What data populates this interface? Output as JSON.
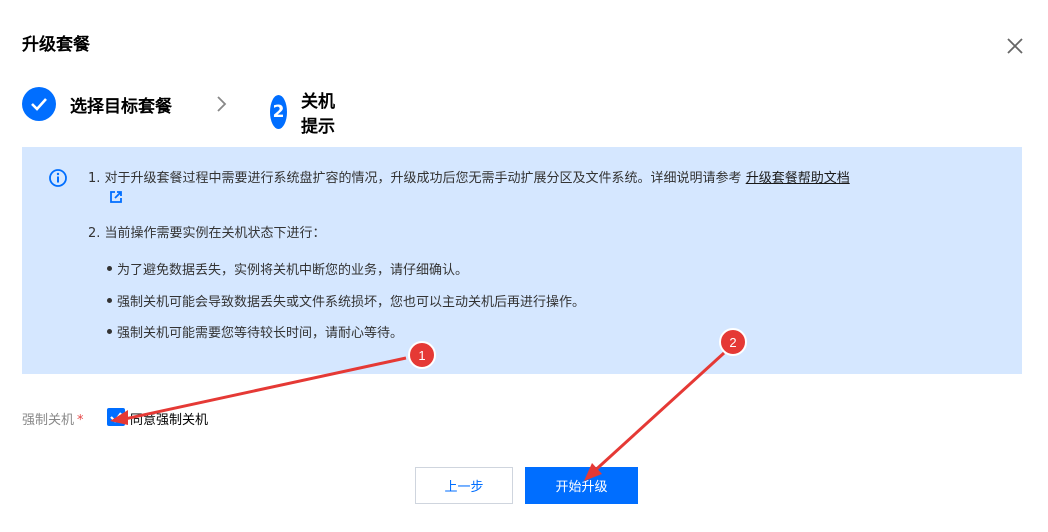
{
  "dialog": {
    "title": "升级套餐"
  },
  "steps": [
    {
      "label": "选择目标套餐",
      "state": "done"
    },
    {
      "number": "2",
      "label": "关机提示",
      "state": "active"
    }
  ],
  "notice": {
    "item1_text": "1. 对于升级套餐过程中需要进行系统盘扩容的情况，升级成功后您无需手动扩展分区及文件系统。详细说明请参考",
    "item1_link": "升级套餐帮助文档",
    "item2_text": "2. 当前操作需要实例在关机状态下进行：",
    "bullets": [
      "为了避免数据丢失，实例将关机中断您的业务，请仔细确认。",
      "强制关机可能会导致数据丢失或文件系统损坏，您也可以主动关机后再进行操作。",
      "强制关机可能需要您等待较长时间，请耐心等待。"
    ]
  },
  "form": {
    "label": "强制关机",
    "required_mark": "*",
    "checkbox_label": "同意强制关机",
    "checkbox_checked": true
  },
  "buttons": {
    "prev": "上一步",
    "start": "开始升级"
  },
  "annotations": [
    {
      "number": "1"
    },
    {
      "number": "2"
    }
  ],
  "colors": {
    "primary": "#006eff",
    "notice_bg": "#d5e7ff",
    "annotation": "#e53935"
  }
}
